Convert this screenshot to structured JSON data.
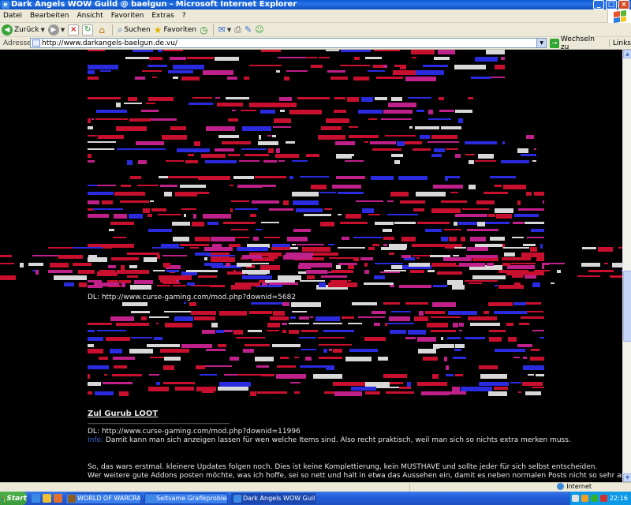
{
  "window": {
    "title": "Dark Angels WOW Guild @ baelgun - Microsoft Internet Explorer"
  },
  "menu": [
    "Datei",
    "Bearbeiten",
    "Ansicht",
    "Favoriten",
    "Extras",
    "?"
  ],
  "toolbar": {
    "back_label": "Zurück",
    "search_label": "Suchen",
    "favorites_label": "Favoriten"
  },
  "address": {
    "label": "Adresse",
    "url": "http://www.darkangels-baelgun.de.vu/",
    "go_label": "Wechseln zu",
    "links_label": "Links"
  },
  "content": {
    "dl1": "DL: http://www.curse-gaming.com/mod.php?downid=5682",
    "heading": "Zul Gurub LOOT",
    "divider": "--------------------------------------------------------------------------------",
    "dl2": "DL: http://www.curse-gaming.com/mod.php?downid=11996",
    "info_prefix": "Info:",
    "info_text": "Damit kann man sich anzeigen lassen für wen welche Items sind. Also recht praktisch, weil man sich so nichts extra merken muss.",
    "para1": "So, das wars erstmal. kleinere Updates folgen noch. Dies ist keine Komplettierung, kein MUSTHAVE und sollte jeder für sich selbst entscheiden.",
    "para2": "Wer weitere gute Addons posten möchte, was ich hoffe, sei so nett und halt in etwa das Aussehen ein, damit es neben normalen Posts nicht so sehr an der Übersicht"
  },
  "status": {
    "zone": "Internet"
  },
  "taskbar": {
    "start_label": "Start",
    "tasks": [
      {
        "label": "WORLD OF WARCRAFT",
        "active": false
      },
      {
        "label": "Seltsame Grafikprobleme...",
        "active": false
      },
      {
        "label": "Dark Angels WOW Guil...",
        "active": true
      }
    ],
    "clock": "22:16"
  },
  "colors": {
    "glitch_red": "#c8102e",
    "glitch_magenta": "#c0208a",
    "glitch_blue": "#2a2adf",
    "glitch_white": "#d8d8d8"
  }
}
